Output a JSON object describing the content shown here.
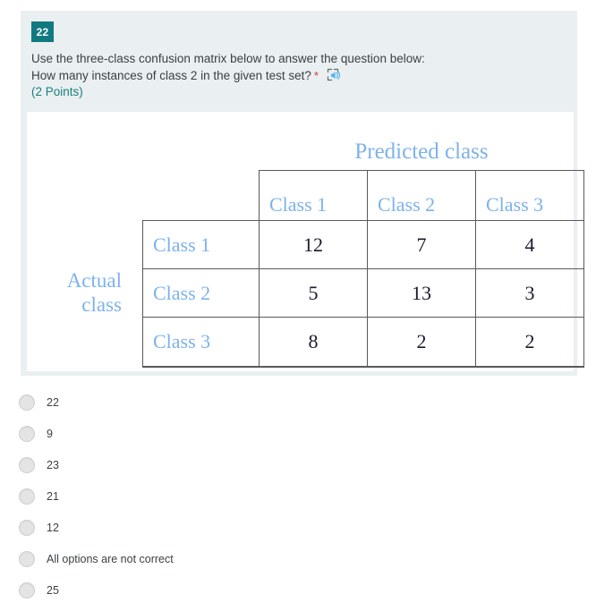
{
  "question": {
    "number": "22",
    "prompt_line1": "Use the three-class confusion matrix below to answer the question below:",
    "prompt_line2": "How many instances of class 2 in the given test set?",
    "required_marker": "*",
    "points": "(2 Points)",
    "reader_icon": "immersive-reader-icon"
  },
  "matrix": {
    "column_axis_title": "Predicted class",
    "row_axis_title_line1": "Actual",
    "row_axis_title_line2": "class",
    "column_headers": [
      "Class 1",
      "Class 2",
      "Class 3"
    ],
    "row_headers": [
      "Class 1",
      "Class 2",
      "Class 3"
    ],
    "rows": [
      [
        "12",
        "7",
        "4"
      ],
      [
        "5",
        "13",
        "3"
      ],
      [
        "8",
        "2",
        "2"
      ]
    ]
  },
  "options": [
    {
      "label": "22"
    },
    {
      "label": "9"
    },
    {
      "label": "23"
    },
    {
      "label": "21"
    },
    {
      "label": "12"
    },
    {
      "label": "All options are not correct"
    },
    {
      "label": "25"
    }
  ],
  "colors": {
    "panel_background": "#eaeff1",
    "number_badge": "#117a80",
    "points_text": "#1b7f7f",
    "required_star": "#d03c3c",
    "matrix_label_blue": "#7db2ec",
    "matrix_value_text": "#1a1a2e",
    "grid_line": "#595959"
  }
}
